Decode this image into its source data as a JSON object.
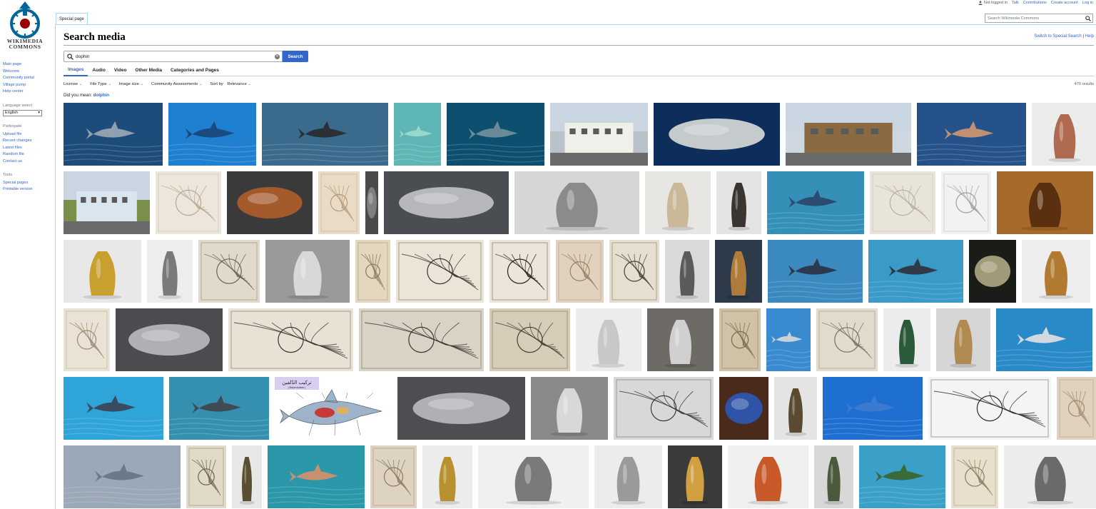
{
  "logo": {
    "line1": "WIKIMEDIA",
    "line2": "COMMONS"
  },
  "personal_tools": {
    "status": "Not logged in",
    "talk": "Talk",
    "contributions": "Contributions",
    "create_account": "Create account",
    "login": "Log in"
  },
  "sidebar": {
    "nav": [
      "Main page",
      "Welcome",
      "Community portal",
      "Village pump",
      "Help center"
    ],
    "language_title": "Language select",
    "language_value": "English",
    "participate_title": "Participate",
    "participate": [
      "Upload file",
      "Recent changes",
      "Latest files",
      "Random file",
      "Contact us"
    ],
    "tools_title": "Tools",
    "tools": [
      "Special pages",
      "Printable version"
    ]
  },
  "tabs": {
    "special": "Special page"
  },
  "top_search": {
    "placeholder": "Search Wikimedia Commons"
  },
  "page": {
    "title": "Search media",
    "switch_link": "Switch to Special:Search",
    "separator": "|",
    "help_link": "Help"
  },
  "search": {
    "value": "dophin",
    "button": "Search"
  },
  "media_tabs": [
    "Images",
    "Audio",
    "Video",
    "Other Media",
    "Categories and Pages"
  ],
  "filters": [
    "License",
    "File Type",
    "Image size",
    "Community Assessments"
  ],
  "sort": {
    "label": "Sort by",
    "value": "Relevance"
  },
  "results_count": "470 results",
  "did_you_mean": {
    "prefix": "Did you mean:",
    "suggestion": "dolphin"
  },
  "diagram_caption": {
    "arabic": "تركيب الدّلفين",
    "latin": "(Dolphinidae)"
  },
  "colors": {
    "link": "#3366cc",
    "border": "#a7d7f9",
    "button": "#3366cc"
  },
  "grid": [
    [
      {
        "w": 139,
        "kind": "sea",
        "bg": "#1e4c7a",
        "fg": "#8fa0b0",
        "subj": "dolphin"
      },
      {
        "w": 123,
        "kind": "sea",
        "bg": "#1f7fd0",
        "fg": "#1a4a80",
        "subj": "dolphins"
      },
      {
        "w": 177,
        "kind": "sea",
        "bg": "#3a6a8c",
        "fg": "#2a3035",
        "subj": "dolphin"
      },
      {
        "w": 66,
        "kind": "sea",
        "bg": "#5fb7b5",
        "fg": "#9bd8cc",
        "subj": "dolphin"
      },
      {
        "w": 137,
        "kind": "sea",
        "bg": "#0d4f6e",
        "fg": "#6b8a98",
        "subj": "dolphin"
      },
      {
        "w": 137,
        "kind": "photo",
        "bg": "#b9c2c8",
        "fg": "#f0f0ea",
        "subj": "building"
      },
      {
        "w": 177,
        "kind": "dark",
        "bg": "#0d2d5a",
        "fg": "#e6e6e0",
        "subj": "skeleton"
      },
      {
        "w": 176,
        "kind": "photo",
        "bg": "#cfd8e0",
        "fg": "#8a6a40",
        "subj": "mural"
      },
      {
        "w": 153,
        "kind": "sea",
        "bg": "#25528a",
        "fg": "#c09070",
        "subj": "dolphin"
      },
      {
        "w": 92,
        "kind": "obj",
        "bg": "#ececec",
        "fg": "#b06a50",
        "subj": "lamp"
      }
    ],
    [
      {
        "w": 121,
        "kind": "photo",
        "bg": "#7a8f4a",
        "fg": "#d9e6ef",
        "subj": "fountain"
      },
      {
        "w": 92,
        "kind": "paper",
        "bg": "#ede6dc",
        "fg": "#b9a890",
        "subj": "fan"
      },
      {
        "w": 120,
        "kind": "dark",
        "bg": "#3a3a3a",
        "fg": "#b8602a",
        "subj": "plate"
      },
      {
        "w": 58,
        "kind": "paper",
        "bg": "#e9dcc6",
        "fg": "#b59a78",
        "subj": "drawing"
      },
      {
        "w": 18,
        "kind": "dark",
        "bg": "#4a4a4a",
        "fg": "#888888",
        "subj": "strip"
      },
      {
        "w": 175,
        "kind": "dark",
        "bg": "#4a4d52",
        "fg": "#c8cace",
        "subj": "crystal"
      },
      {
        "w": 175,
        "kind": "obj",
        "bg": "#d6d6d6",
        "fg": "#8b8b8b",
        "subj": "spoon"
      },
      {
        "w": 92,
        "kind": "obj",
        "bg": "#e8e6e2",
        "fg": "#c9b998",
        "subj": "bottle"
      },
      {
        "w": 63,
        "kind": "obj",
        "bg": "#e4e4e4",
        "fg": "#3a3530",
        "subj": "statue"
      },
      {
        "w": 136,
        "kind": "sea",
        "bg": "#3590b8",
        "fg": "#2a4c70",
        "subj": "show"
      },
      {
        "w": 92,
        "kind": "paper",
        "bg": "#e8e4da",
        "fg": "#b8b0a0",
        "subj": "round"
      },
      {
        "w": 70,
        "kind": "paper",
        "bg": "#f2f2f0",
        "fg": "#a0a0a0",
        "subj": "sketch"
      },
      {
        "w": 135,
        "kind": "obj",
        "bg": "#a86a2a",
        "fg": "#5a3010",
        "subj": "textile"
      }
    ],
    [
      {
        "w": 109,
        "kind": "obj",
        "bg": "#e8e8e8",
        "fg": "#c8a030",
        "subj": "gold"
      },
      {
        "w": 64,
        "kind": "obj",
        "bg": "#ededed",
        "fg": "#7a7a7a",
        "subj": "pair"
      },
      {
        "w": 86,
        "kind": "paper",
        "bg": "#e1dacc",
        "fg": "#6a6050",
        "subj": "medal"
      },
      {
        "w": 118,
        "kind": "obj",
        "bg": "#9a9a9a",
        "fg": "#d8d8d8",
        "subj": "salt"
      },
      {
        "w": 49,
        "kind": "paper",
        "bg": "#e3d7bf",
        "fg": "#8a7658",
        "subj": "drawing"
      },
      {
        "w": 123,
        "kind": "paper",
        "bg": "#ebe5d8",
        "fg": "#3a3530",
        "subj": "engraving"
      },
      {
        "w": 85,
        "kind": "paper",
        "bg": "#ece6da",
        "fg": "#2a2520",
        "subj": "letter"
      },
      {
        "w": 67,
        "kind": "paper",
        "bg": "#e0d2bd",
        "fg": "#9a8068",
        "subj": "sketch"
      },
      {
        "w": 70,
        "kind": "paper",
        "bg": "#e6dfd0",
        "fg": "#4a4038",
        "subj": "pattern"
      },
      {
        "w": 62,
        "kind": "obj",
        "bg": "#d9d9d9",
        "fg": "#5a5a5a",
        "subj": "candle"
      },
      {
        "w": 66,
        "kind": "obj",
        "bg": "#2c3a4a",
        "fg": "#b07a3a",
        "subj": "vase"
      },
      {
        "w": 133,
        "kind": "sea",
        "bg": "#3a8ac0",
        "fg": "#2c3a50",
        "subj": "show"
      },
      {
        "w": 133,
        "kind": "sea",
        "bg": "#3a9ac8",
        "fg": "#303a48",
        "subj": "show"
      },
      {
        "w": 66,
        "kind": "dark",
        "bg": "#1a1c18",
        "fg": "#b8b08a",
        "subj": "skeleton"
      },
      {
        "w": 96,
        "kind": "obj",
        "bg": "#eeeeee",
        "fg": "#b07a30",
        "subj": "ring"
      }
    ],
    [
      {
        "w": 65,
        "kind": "paper",
        "bg": "#eae3d5",
        "fg": "#9a8a70",
        "subj": "fountain"
      },
      {
        "w": 150,
        "kind": "dark",
        "bg": "#4a4c50",
        "fg": "#bfc2c8",
        "subj": "crystal"
      },
      {
        "w": 175,
        "kind": "paper",
        "bg": "#e8e2d4",
        "fg": "#3a3530",
        "subj": "cartouche"
      },
      {
        "w": 175,
        "kind": "paper",
        "bg": "#d9d3c6",
        "fg": "#3a3530",
        "subj": "ornament"
      },
      {
        "w": 113,
        "kind": "paper",
        "bg": "#d6ccb8",
        "fg": "#4a4038",
        "subj": "engraving"
      },
      {
        "w": 92,
        "kind": "obj",
        "bg": "#ececec",
        "fg": "#c8c8c8",
        "subj": "plate"
      },
      {
        "w": 93,
        "kind": "obj",
        "bg": "#6e6a66",
        "fg": "#d0d0d0",
        "subj": "ewer"
      },
      {
        "w": 58,
        "kind": "paper",
        "bg": "#cfc2a6",
        "fg": "#7a6a50",
        "subj": "page"
      },
      {
        "w": 62,
        "kind": "sea",
        "bg": "#3a8ad0",
        "fg": "#c8d0d8",
        "subj": "dolphin"
      },
      {
        "w": 86,
        "kind": "paper",
        "bg": "#e1dbce",
        "fg": "#7a7060",
        "subj": "medal"
      },
      {
        "w": 66,
        "kind": "obj",
        "bg": "#ececec",
        "fg": "#2a5a3a",
        "subj": "vase"
      },
      {
        "w": 76,
        "kind": "obj",
        "bg": "#d6d6d6",
        "fg": "#b08a50",
        "subj": "cup"
      },
      {
        "w": 135,
        "kind": "sea",
        "bg": "#2a8ac8",
        "fg": "#d0d8e0",
        "subj": "pool"
      }
    ],
    [
      {
        "w": 140,
        "kind": "sea",
        "bg": "#2fa4d8",
        "fg": "#3a4a60",
        "subj": "dolphin"
      },
      {
        "w": 140,
        "kind": "sea",
        "bg": "#3590b0",
        "fg": "#404a55",
        "subj": "show"
      },
      {
        "w": 164,
        "kind": "diagram",
        "bg": "#ffffff",
        "fg": "#8aa0b8",
        "subj": "diagram"
      },
      {
        "w": 179,
        "kind": "dark",
        "bg": "#4c4e52",
        "fg": "#c0c2c6",
        "subj": "crystal"
      },
      {
        "w": 108,
        "kind": "obj",
        "bg": "#8a8a8a",
        "fg": "#d8d8d8",
        "subj": "ewers"
      },
      {
        "w": 140,
        "kind": "paper",
        "bg": "#d8d8d8",
        "fg": "#3a3a3a",
        "subj": "mosaic"
      },
      {
        "w": 69,
        "kind": "dark",
        "bg": "#4a2a1a",
        "fg": "#2a5ac0",
        "subj": "pair"
      },
      {
        "w": 60,
        "kind": "obj",
        "bg": "#e4e4e4",
        "fg": "#5a4a30",
        "subj": "vase"
      },
      {
        "w": 140,
        "kind": "sea",
        "bg": "#1f6fd0",
        "fg": "#3a7ad0",
        "subj": "dolphin"
      },
      {
        "w": 172,
        "kind": "paper",
        "bg": "#f4f4f2",
        "fg": "#2a2a2a",
        "subj": "sketch"
      },
      {
        "w": 55,
        "kind": "paper",
        "bg": "#e0d2bc",
        "fg": "#a08a70",
        "subj": "drawing"
      }
    ],
    [
      {
        "w": 164,
        "kind": "sea",
        "bg": "#9aa8b8",
        "fg": "#6a7a8a",
        "subj": "bay"
      },
      {
        "w": 56,
        "kind": "paper",
        "bg": "#e2dac8",
        "fg": "#6a6050",
        "subj": "sketch"
      },
      {
        "w": 42,
        "kind": "obj",
        "bg": "#e8e8e8",
        "fg": "#5a5030",
        "subj": "stand"
      },
      {
        "w": 136,
        "kind": "sea",
        "bg": "#2a98a8",
        "fg": "#c89070",
        "subj": "swim"
      },
      {
        "w": 65,
        "kind": "paper",
        "bg": "#ddd3c0",
        "fg": "#8a7a60",
        "subj": "drawing"
      },
      {
        "w": 70,
        "kind": "obj",
        "bg": "#ececec",
        "fg": "#b89030",
        "subj": "jewel"
      },
      {
        "w": 155,
        "kind": "obj",
        "bg": "#f0f0f0",
        "fg": "#7a7a7a",
        "subj": "seal"
      },
      {
        "w": 95,
        "kind": "obj",
        "bg": "#ececec",
        "fg": "#9a9a9a",
        "subj": "plate"
      },
      {
        "w": 76,
        "kind": "obj",
        "bg": "#3a3a3a",
        "fg": "#d0a040",
        "subj": "pot"
      },
      {
        "w": 113,
        "kind": "obj",
        "bg": "#f0f0f0",
        "fg": "#c85a2a",
        "subj": "vase"
      },
      {
        "w": 55,
        "kind": "obj",
        "bg": "#d8d8d8",
        "fg": "#4a5a3a",
        "subj": "stand"
      },
      {
        "w": 121,
        "kind": "sea",
        "bg": "#3aa0c8",
        "fg": "#3a6a3a",
        "subj": "park"
      },
      {
        "w": 66,
        "kind": "paper",
        "bg": "#e8e0cc",
        "fg": "#8a7a60",
        "subj": "drawing"
      },
      {
        "w": 130,
        "kind": "obj",
        "bg": "#ececec",
        "fg": "#6a6a6a",
        "subj": "rings"
      }
    ]
  ]
}
